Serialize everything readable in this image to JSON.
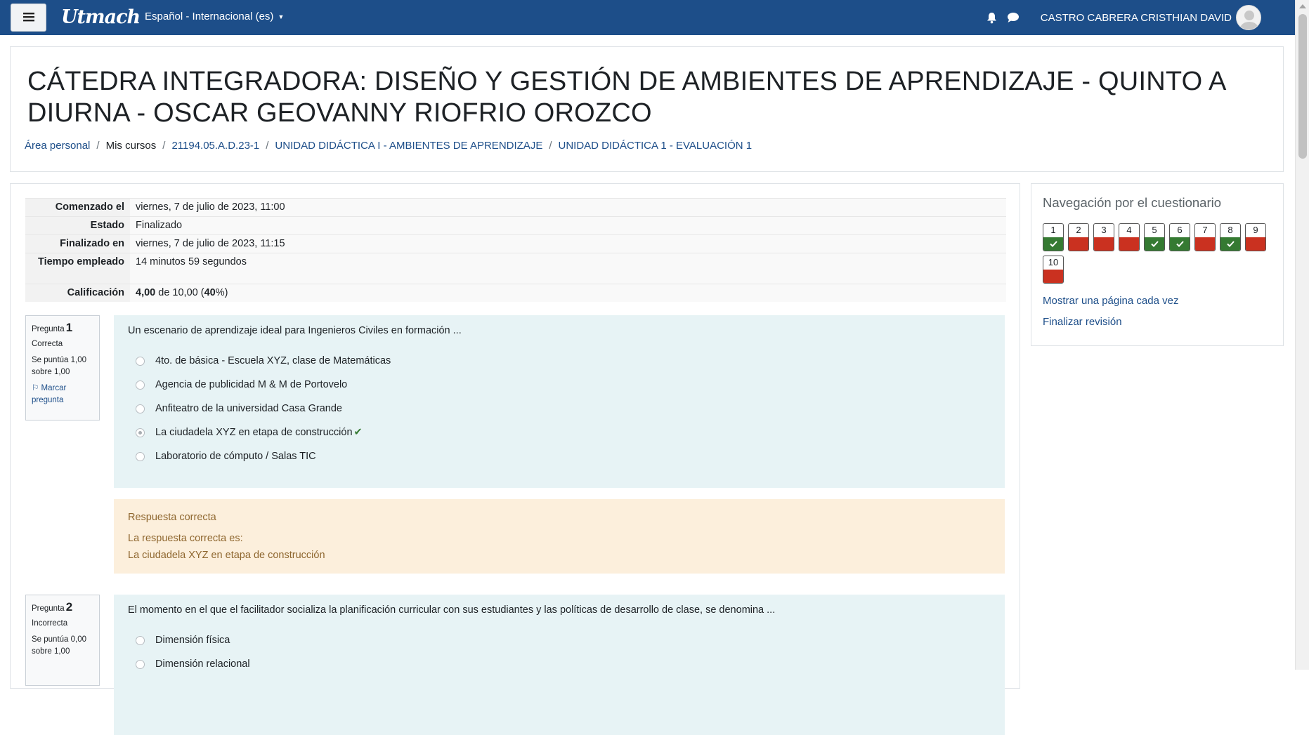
{
  "navbar": {
    "brand": "Utmach",
    "language": "Español - Internacional (es)",
    "user_name": "CASTRO CABRERA CRISTHIAN DAVID",
    "colors": {
      "background": "#1d4e89",
      "text": "#ffffff"
    },
    "icons": [
      "menu-icon",
      "bell-icon",
      "chat-icon",
      "user-avatar-icon"
    ]
  },
  "header": {
    "title": "CÁTEDRA INTEGRADORA: DISEÑO Y GESTIÓN DE AMBIENTES DE APRENDIZAJE - QUINTO A DIURNA - OSCAR GEOVANNY RIOFRIO OROZCO",
    "breadcrumb": [
      "Área personal",
      "Mis cursos",
      "21194.05.A.D.23-1",
      "UNIDAD DIDÁCTICA I - AMBIENTES DE APRENDIZAJE",
      "UNIDAD DIDÁCTICA 1 - EVALUACIÓN 1"
    ]
  },
  "summary": {
    "started_label": "Comenzado el",
    "started_value": "viernes, 7 de julio de 2023, 11:00",
    "state_label": "Estado",
    "state_value": "Finalizado",
    "finished_label": "Finalizado en",
    "finished_value": "viernes, 7 de julio de 2023, 11:15",
    "time_label": "Tiempo empleado",
    "time_value": "14 minutos 59 segundos",
    "grade_label": "Calificación",
    "grade_score": "4,00",
    "grade_of": "de 10,00 (",
    "grade_percent": "40",
    "grade_close": "%)"
  },
  "questions": [
    {
      "label": "Pregunta",
      "number": "1",
      "state": "Correcta",
      "grade": "Se puntúa 1,00 sobre 1,00",
      "flag": "Marcar pregunta",
      "text": "Un escenario de aprendizaje ideal para Ingenieros Civiles en formación ...",
      "options": [
        "4to. de básica - Escuela XYZ, clase de Matemáticas",
        "Agencia de publicidad M & M de Portovelo",
        "Anfiteatro de la universidad Casa Grande",
        "La ciudadela XYZ en etapa de construcción",
        "Laboratorio de cómputo / Salas TIC"
      ],
      "selected_index": 3,
      "feedback_title": "Respuesta correcta",
      "feedback_intro": "La respuesta correcta es:",
      "feedback_answer": "La ciudadela XYZ en etapa de construcción"
    },
    {
      "label": "Pregunta",
      "number": "2",
      "state": "Incorrecta",
      "grade": "Se puntúa 0,00 sobre 1,00",
      "text": "El momento en el que el facilitador socializa la planificación curricular con sus estudiantes y las políticas de desarrollo de clase, se denomina ...",
      "options": [
        "Dimensión física",
        "Dimensión relacional"
      ]
    }
  ],
  "quiz_nav": {
    "title": "Navegación por el cuestionario",
    "buttons": [
      {
        "number": "1",
        "status": "correct"
      },
      {
        "number": "2",
        "status": "incorrect"
      },
      {
        "number": "3",
        "status": "incorrect"
      },
      {
        "number": "4",
        "status": "incorrect"
      },
      {
        "number": "5",
        "status": "correct"
      },
      {
        "number": "6",
        "status": "correct"
      },
      {
        "number": "7",
        "status": "incorrect"
      },
      {
        "number": "8",
        "status": "correct"
      },
      {
        "number": "9",
        "status": "incorrect"
      },
      {
        "number": "10",
        "status": "incorrect"
      }
    ],
    "show_one_page": "Mostrar una página cada vez",
    "finish_review": "Finalizar revisión",
    "colors": {
      "correct": "#357a32",
      "incorrect": "#ca3120"
    }
  }
}
